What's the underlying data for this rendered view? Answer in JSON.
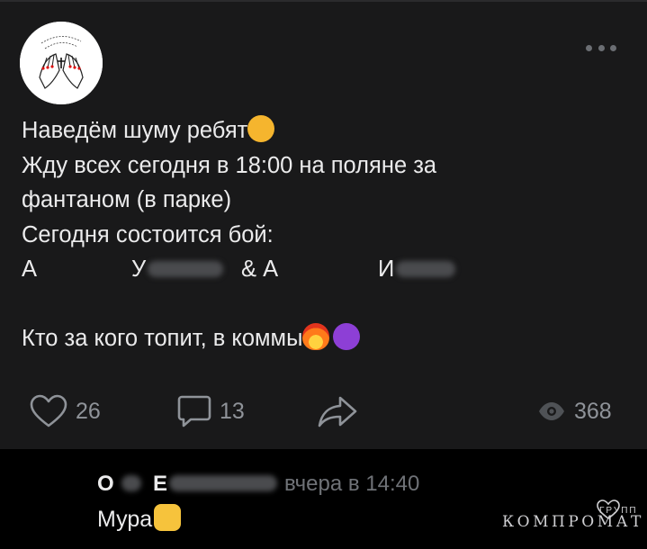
{
  "post": {
    "lines": [
      "Наведём шуму ребят",
      "Жду всех сегодня в 18:00 на поляне за",
      "фантаном (в парке)",
      "Сегодня состоится бой:"
    ],
    "fight_a1": "А",
    "fight_n1": "У",
    "fight_mid": "& А",
    "fight_n2": "И",
    "last_line": "Кто за кого топит, в коммы",
    "emoji": [
      "cat-smirk-emoji",
      "fire-emoji",
      "smiling-devil-emoji"
    ]
  },
  "actions": {
    "likes": "26",
    "comments": "13",
    "views": "368"
  },
  "comment": {
    "author_first": "О",
    "author_last": "Е",
    "time": "вчера в 14:40",
    "text": "Мура"
  },
  "watermark": {
    "text": "КОМПРОМАТ",
    "small": "ГРУПП"
  },
  "colors": {
    "post_bg": "#19191a",
    "page_bg": "#000000",
    "text": "#ebebec",
    "muted": "#8f9399"
  }
}
